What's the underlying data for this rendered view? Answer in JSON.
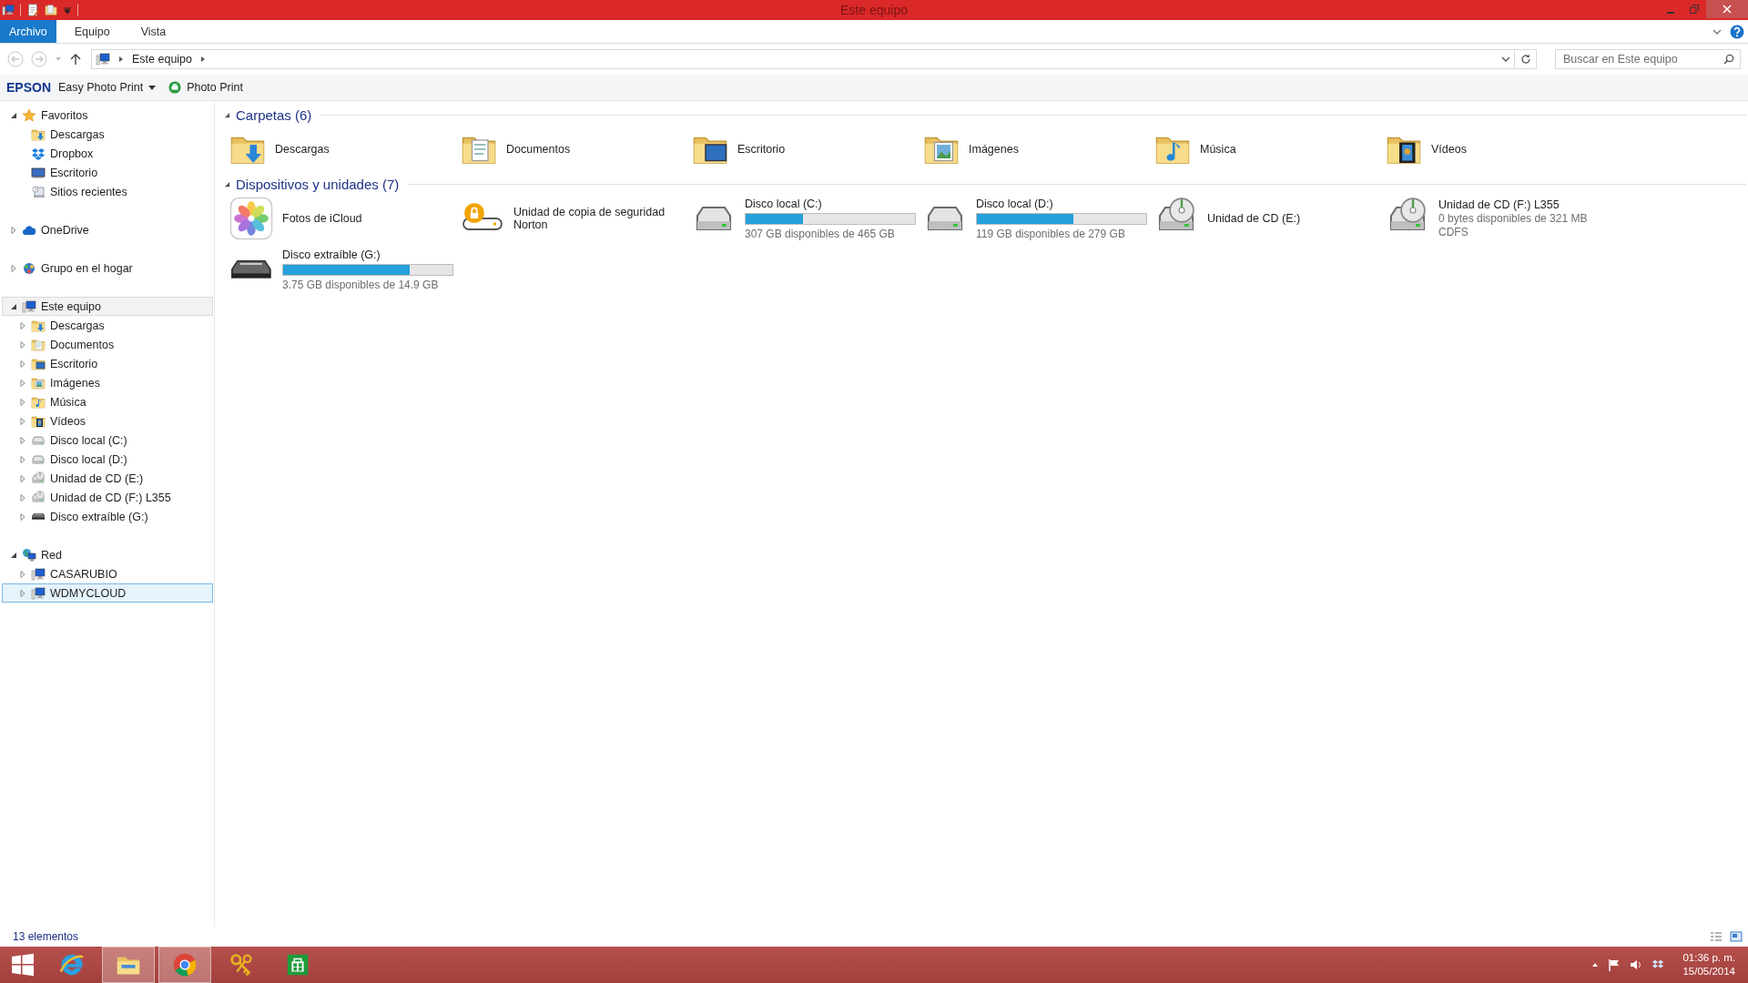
{
  "window": {
    "title": "Este equipo"
  },
  "ribbon_tabs": [
    {
      "label": "Archivo",
      "selected": true
    },
    {
      "label": "Equipo",
      "selected": false
    },
    {
      "label": "Vista",
      "selected": false
    }
  ],
  "address_bar": {
    "path": [
      "Este equipo"
    ]
  },
  "search": {
    "placeholder": "Buscar en Este equipo"
  },
  "epson_toolbar": {
    "brand": "EPSON",
    "items": [
      {
        "label": "Easy Photo Print",
        "kind": "dropdown"
      },
      {
        "label": "Photo Print",
        "kind": "printer"
      }
    ]
  },
  "navigation": [
    {
      "label": "Favoritos",
      "kind": "star",
      "expanded": true,
      "selected": false,
      "hovered": false,
      "children": [
        {
          "label": "Descargas",
          "kind": "folder-download",
          "selected": false,
          "hovered": false
        },
        {
          "label": "Dropbox",
          "kind": "dropbox",
          "selected": false,
          "hovered": false
        },
        {
          "label": "Escritorio",
          "kind": "desktop",
          "selected": false,
          "hovered": false
        },
        {
          "label": "Sitios recientes",
          "kind": "recent",
          "selected": false,
          "hovered": false
        }
      ]
    },
    {
      "label": "OneDrive",
      "kind": "cloud",
      "expanded": false,
      "selected": false,
      "hovered": false
    },
    {
      "label": "Grupo en el hogar",
      "kind": "homegroup",
      "expanded": false,
      "selected": false,
      "hovered": false
    },
    {
      "label": "Este equipo",
      "kind": "computer",
      "expanded": true,
      "selected": false,
      "hovered": true,
      "children": [
        {
          "label": "Descargas",
          "kind": "folder-download",
          "expanded": false,
          "selected": false,
          "hovered": false
        },
        {
          "label": "Documentos",
          "kind": "folder-docs",
          "expanded": false,
          "selected": false,
          "hovered": false
        },
        {
          "label": "Escritorio",
          "kind": "folder-desktop",
          "expanded": false,
          "selected": false,
          "hovered": false
        },
        {
          "label": "Imágenes",
          "kind": "folder-images",
          "expanded": false,
          "selected": false,
          "hovered": false
        },
        {
          "label": "Música",
          "kind": "folder-music",
          "expanded": false,
          "selected": false,
          "hovered": false
        },
        {
          "label": "Vídeos",
          "kind": "folder-videos",
          "expanded": false,
          "selected": false,
          "hovered": false
        },
        {
          "label": "Disco local (C:)",
          "kind": "disk",
          "expanded": false,
          "selected": false,
          "hovered": false
        },
        {
          "label": "Disco local (D:)",
          "kind": "disk",
          "expanded": false,
          "selected": false,
          "hovered": false
        },
        {
          "label": "Unidad de CD (E:)",
          "kind": "cd",
          "expanded": false,
          "selected": false,
          "hovered": false
        },
        {
          "label": "Unidad de CD (F:) L355",
          "kind": "cd",
          "expanded": false,
          "selected": false,
          "hovered": false
        },
        {
          "label": "Disco extraíble (G:)",
          "kind": "removable",
          "expanded": false,
          "selected": false,
          "hovered": false
        }
      ]
    },
    {
      "label": "Red",
      "kind": "network",
      "expanded": true,
      "selected": false,
      "hovered": false,
      "children": [
        {
          "label": "CASARUBIO",
          "kind": "computer",
          "expanded": false,
          "selected": false,
          "hovered": false
        },
        {
          "label": "WDMYCLOUD",
          "kind": "computer",
          "expanded": false,
          "selected": true,
          "hovered": false
        }
      ]
    }
  ],
  "sections": [
    {
      "title": "Carpetas (6)",
      "expanded": true,
      "items": [
        {
          "name": "Descargas",
          "kind": "folder-download"
        },
        {
          "name": "Documentos",
          "kind": "folder-docs"
        },
        {
          "name": "Escritorio",
          "kind": "folder-desktop"
        },
        {
          "name": "Imágenes",
          "kind": "folder-images"
        },
        {
          "name": "Música",
          "kind": "folder-music"
        },
        {
          "name": "Vídeos",
          "kind": "folder-videos"
        }
      ]
    },
    {
      "title": "Dispositivos y unidades (7)",
      "expanded": true,
      "items": [
        {
          "name": "Fotos de iCloud",
          "kind": "photos"
        },
        {
          "name": "Unidad de copia de seguridad Norton",
          "kind": "backup"
        },
        {
          "name": "Disco local (C:)",
          "kind": "disk",
          "level": 0.34,
          "detail": "307 GB disponibles de 465 GB"
        },
        {
          "name": "Disco local (D:)",
          "kind": "disk",
          "level": 0.57,
          "detail": "119 GB disponibles de 279 GB"
        },
        {
          "name": "Unidad de CD (E:)",
          "kind": "cd"
        },
        {
          "name": "Unidad de CD (F:) L355",
          "kind": "cd",
          "detail": "0 bytes disponibles de 321 MB",
          "detail_2": "CDFS"
        },
        {
          "name": "Disco extraíble (G:)",
          "kind": "removable",
          "level": 0.75,
          "detail": "3.75 GB disponibles de 14.9 GB"
        }
      ]
    }
  ],
  "status_bar": {
    "count": "13 elementos"
  },
  "taskbar": {
    "apps": [
      {
        "kind": "ie",
        "active": false
      },
      {
        "kind": "explorer",
        "active": true
      },
      {
        "kind": "chrome",
        "active": true
      },
      {
        "kind": "keys",
        "active": false
      },
      {
        "kind": "store",
        "active": false
      }
    ],
    "clock": {
      "time": "01:36 p. m.",
      "date": "15/05/2014"
    }
  }
}
